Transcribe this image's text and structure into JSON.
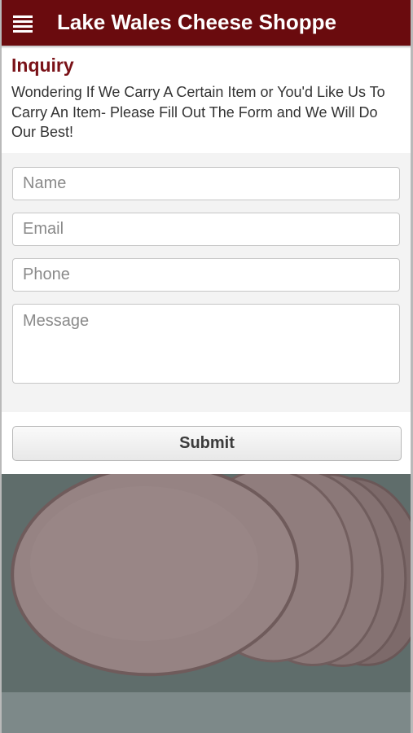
{
  "header": {
    "title": "Lake Wales Cheese Shoppe",
    "menu_icon": "hamburger-menu-icon"
  },
  "intro": {
    "heading": "Inquiry",
    "text": "Wondering If We Carry A Certain Item or You'd Like Us To Carry An Item- Please Fill Out The Form and We Will Do Our Best!"
  },
  "form": {
    "name_placeholder": "Name",
    "email_placeholder": "Email",
    "phone_placeholder": "Phone",
    "message_placeholder": "Message",
    "submit_label": "Submit"
  },
  "colors": {
    "brand": "#6a0b0e",
    "heading": "#7a1218"
  }
}
